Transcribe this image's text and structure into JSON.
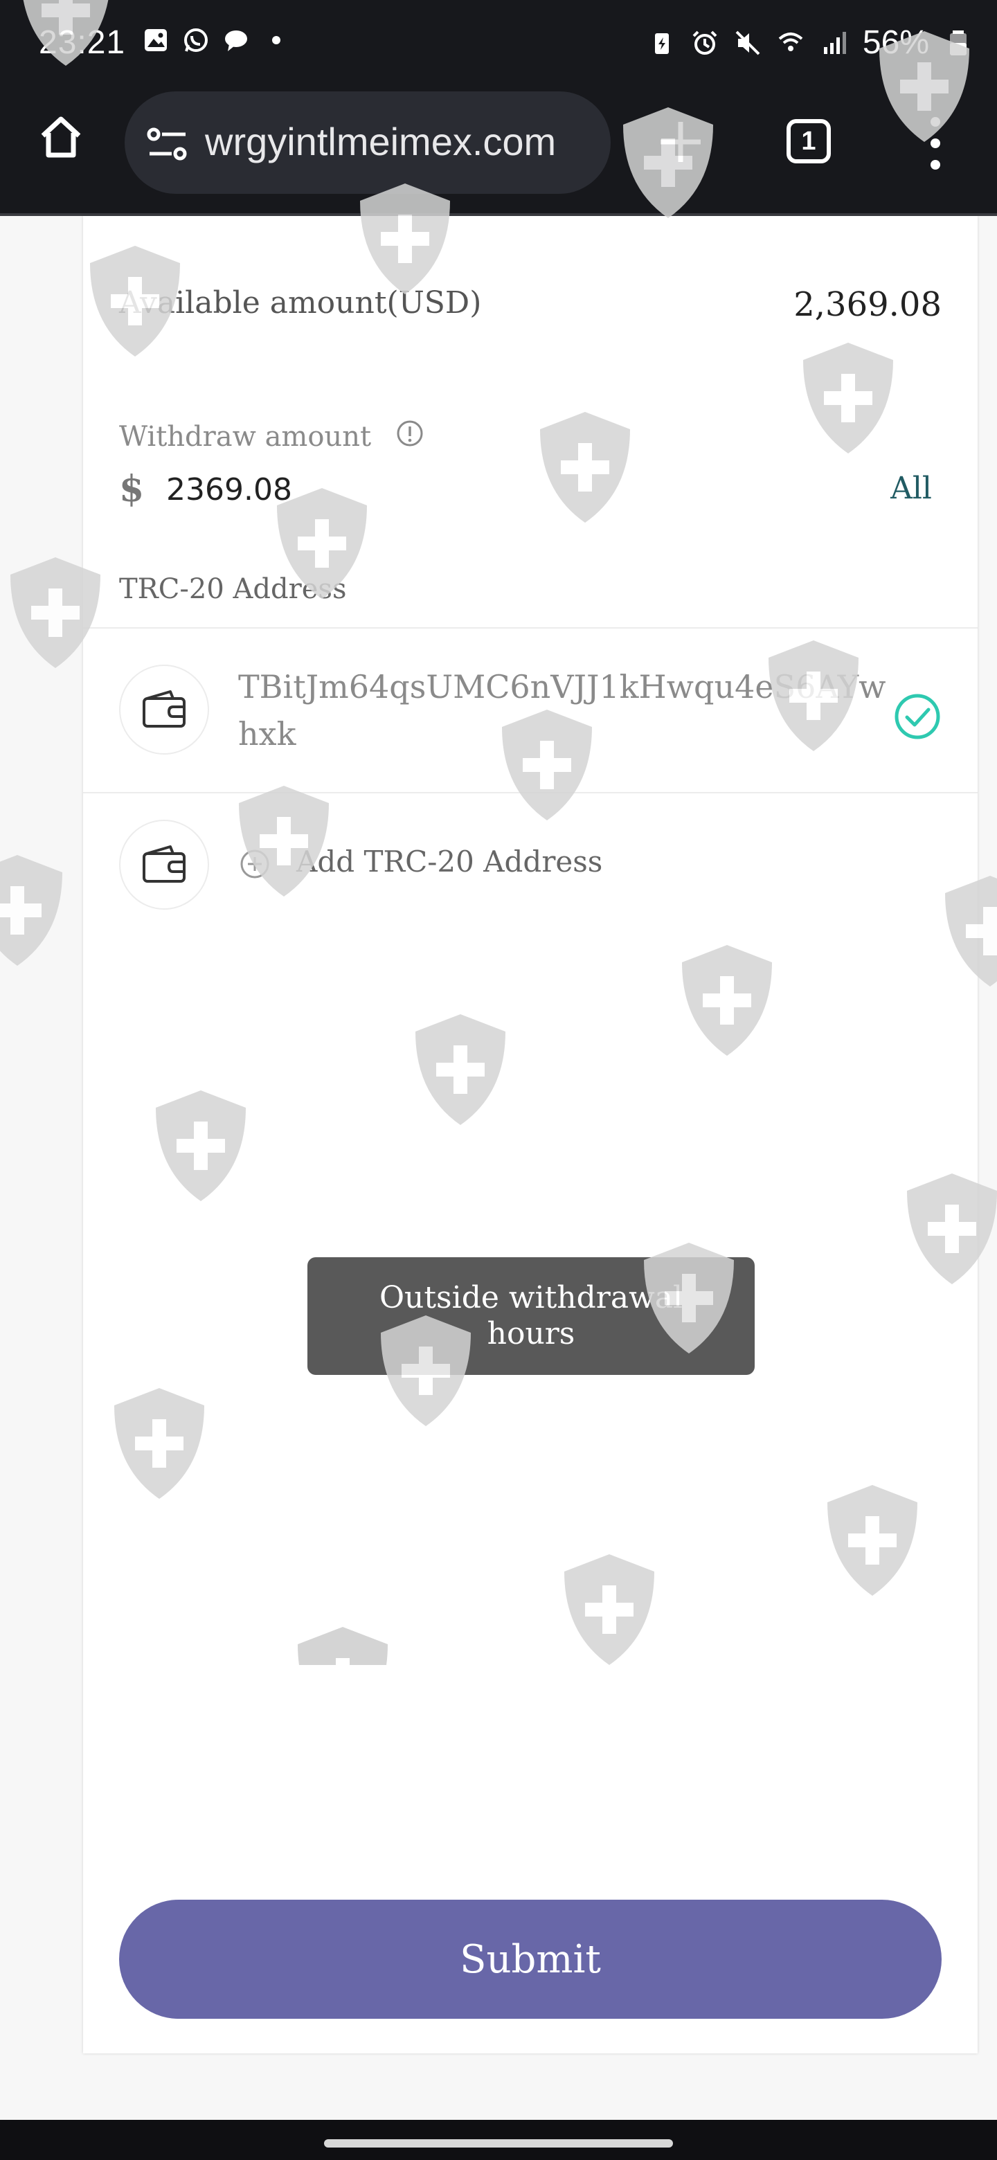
{
  "status_bar": {
    "time": "23:21",
    "battery": "56%"
  },
  "browser": {
    "url": "wrgyintlmeimex.com",
    "tab_count": "1"
  },
  "withdraw": {
    "available_label": "Available amount(USD)",
    "available_value": "2,369.08",
    "withdraw_label": "Withdraw amount",
    "currency_symbol": "$",
    "withdraw_value": "2369.08",
    "all_label": "All",
    "address_section_label": "TRC-20 Address",
    "selected_address": "TBitJm64qsUMC6nVJJ1kHwqu4eS6AYwhxk",
    "add_address_label": "Add TRC-20 Address",
    "submit_label": "Submit"
  },
  "toast": {
    "message": "Outside withdrawal hours"
  },
  "colors": {
    "accent": "#6867a8",
    "check": "#2ec9b0",
    "all_link": "#215b63",
    "chrome": "#17181c"
  }
}
